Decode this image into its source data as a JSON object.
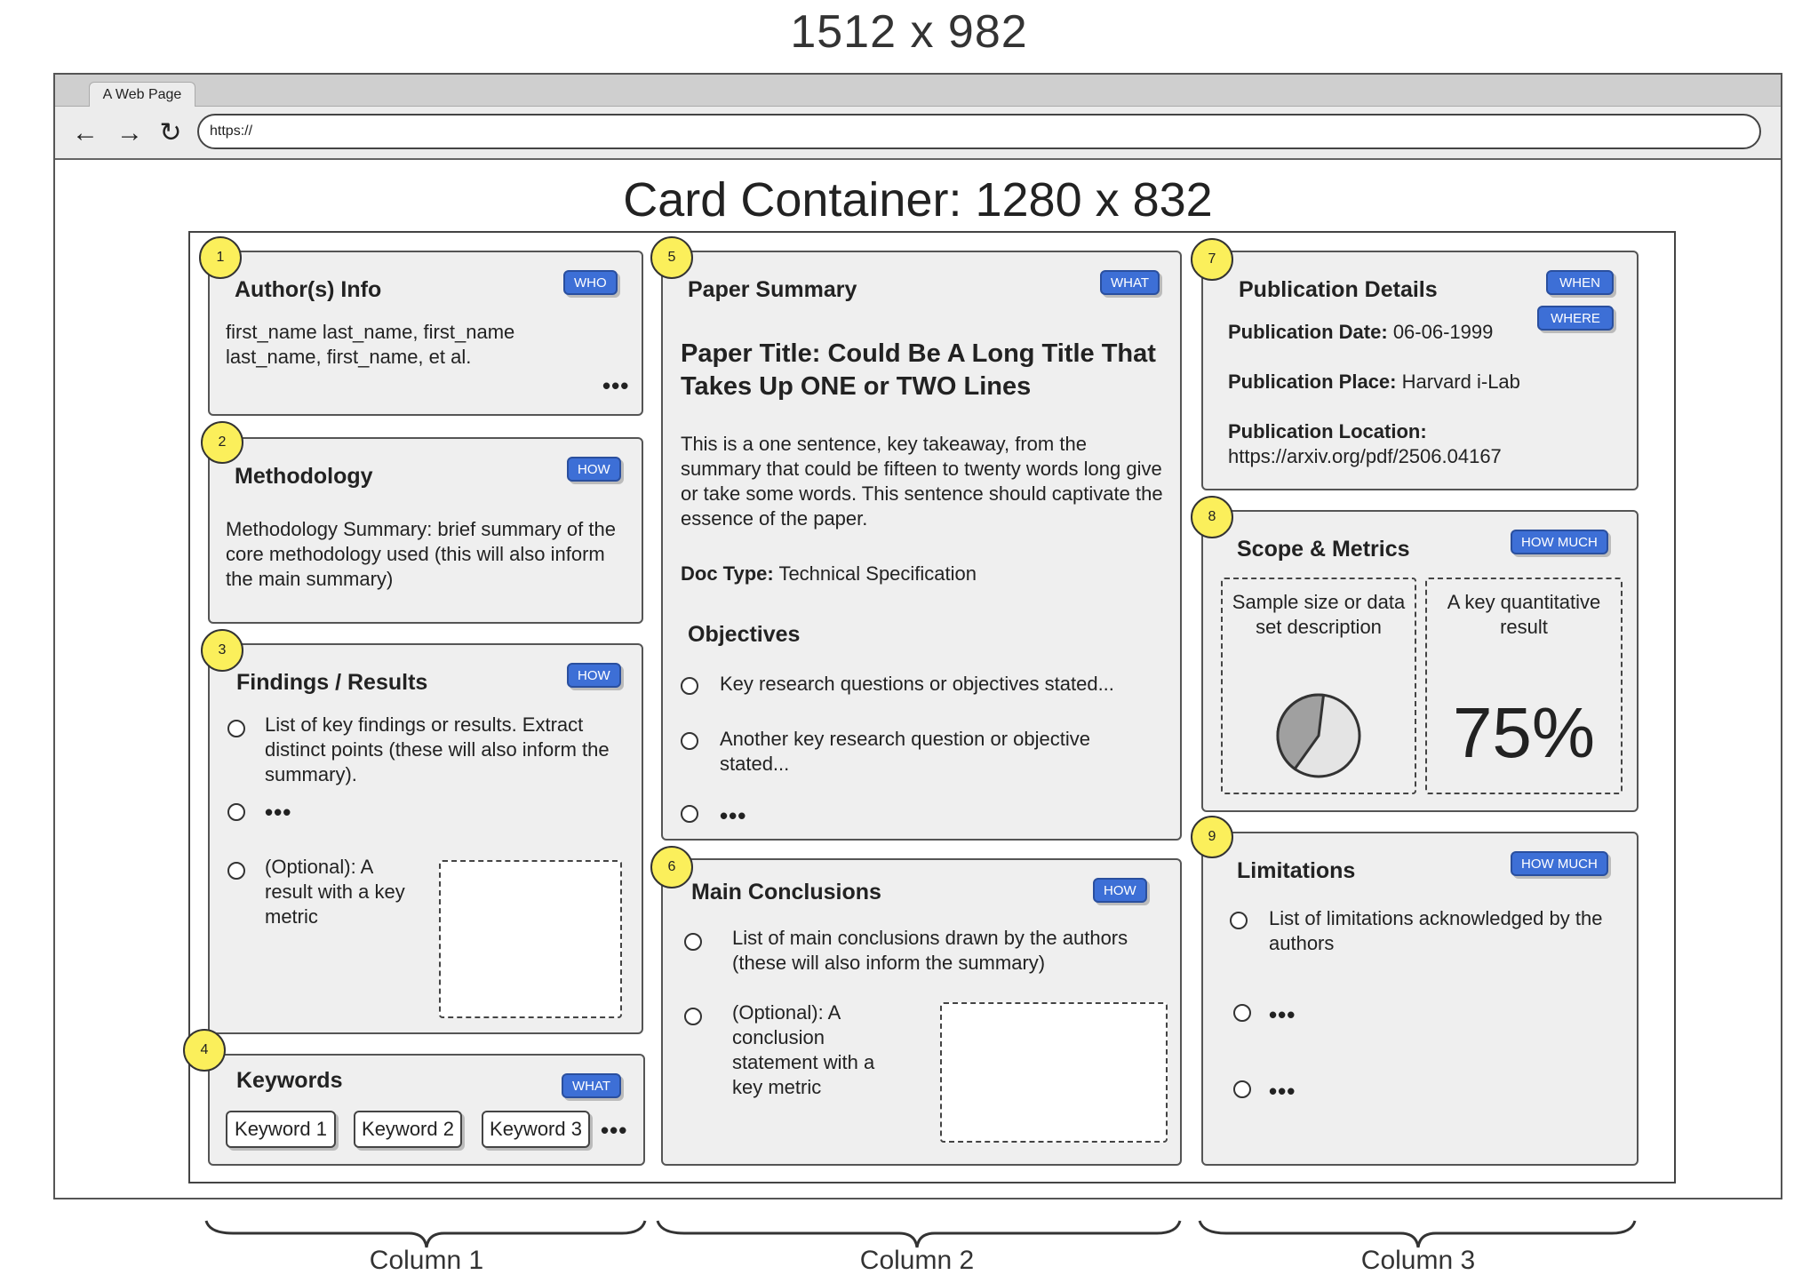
{
  "page": {
    "dimension_label": "1512 x 982",
    "container_label": "Card Container: 1280 x 832"
  },
  "browser": {
    "tab_title": "A Web Page",
    "url": "https://",
    "icons": {
      "back": "arrow-left-icon",
      "forward": "arrow-right-icon",
      "reload": "reload-icon"
    }
  },
  "badge_color": "#3d6fd6",
  "marker_color": "#fbef5b",
  "cards": {
    "authors": {
      "num": "1",
      "title": "Author(s) Info",
      "badge": "WHO",
      "text": "first_name last_name, first_name last_name, first_name, et al.",
      "more": "•••"
    },
    "methodology": {
      "num": "2",
      "title": "Methodology",
      "badge": "HOW",
      "text": "Methodology Summary: brief summary of the core methodology used (this will also inform the main summary)"
    },
    "findings": {
      "num": "3",
      "title": "Findings / Results",
      "badge": "HOW",
      "item1": "List of key findings or results. Extract distinct points (these will also inform the summary).",
      "item2": "•••",
      "item3": "(Optional): A result with a key metric"
    },
    "keywords": {
      "num": "4",
      "title": "Keywords",
      "badge": "WHAT",
      "chips": [
        "Keyword 1",
        "Keyword 2",
        "Keyword 3"
      ],
      "more": "•••"
    },
    "summary": {
      "num": "5",
      "title": "Paper Summary",
      "badge": "WHAT",
      "paper_title": "Paper Title: Could Be A Long Title That Takes Up ONE or TWO Lines",
      "takeaway": "This is a one sentence, key takeaway, from the summary that could be fifteen to twenty words long give or take some words. This sentence should captivate the essence of the paper.",
      "doc_type_label": "Doc Type:",
      "doc_type_value": "Technical Specification",
      "objectives_title": "Objectives",
      "obj1": "Key research questions or objectives stated...",
      "obj2": "Another key research question or objective stated...",
      "obj3": "•••"
    },
    "conclusions": {
      "num": "6",
      "title": "Main Conclusions",
      "badge": "HOW",
      "item1": "List of main conclusions drawn by the authors (these will also inform the summary)",
      "item2": "(Optional): A conclusion statement with a key metric"
    },
    "publication": {
      "num": "7",
      "title": "Publication Details",
      "badge_when": "WHEN",
      "badge_where": "WHERE",
      "date_label": "Publication Date:",
      "date_value": "06-06-1999",
      "place_label": "Publication Place:",
      "place_value": "Harvard i-Lab",
      "location_label": "Publication Location:",
      "location_value": "https://arxiv.org/pdf/2506.04167"
    },
    "scope": {
      "num": "8",
      "title": "Scope & Metrics",
      "badge": "HOW MUCH",
      "sample_text": "Sample size or data set description",
      "metric_text": "A key quantitative result",
      "metric_value": "75%",
      "pie_slice_fraction": 0.42,
      "pie_slice_color": "#a0a0a0",
      "pie_rest_color": "#e4e4e4"
    },
    "limitations": {
      "num": "9",
      "title": "Limitations",
      "badge": "HOW MUCH",
      "item1": "List of limitations acknowledged by the authors",
      "item2": "•••",
      "item3": "•••"
    }
  },
  "columns": [
    "Column 1",
    "Column 2",
    "Column 3"
  ]
}
